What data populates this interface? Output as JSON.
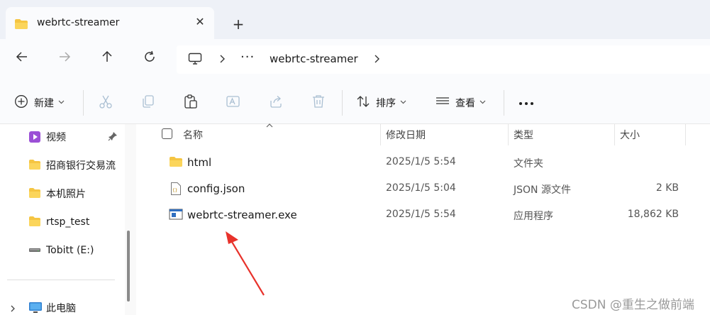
{
  "tab": {
    "title": "webrtc-streamer",
    "close_glyph": "✕",
    "new_glyph": "+"
  },
  "address": {
    "ellipsis": "···",
    "crumb": "webrtc-streamer"
  },
  "toolbar": {
    "new_label": "新建",
    "sort_label": "排序",
    "view_label": "查看",
    "more_glyph": "•••",
    "caret": "⌄"
  },
  "sidebar": {
    "items": [
      {
        "label": "视频",
        "icon": "video-library-icon",
        "pinned": true
      },
      {
        "label": "招商银行交易流",
        "icon": "folder-icon"
      },
      {
        "label": "本机照片",
        "icon": "folder-icon"
      },
      {
        "label": "rtsp_test",
        "icon": "folder-icon"
      },
      {
        "label": "Tobitt (E:)",
        "icon": "drive-icon"
      },
      {
        "label": "此电脑",
        "icon": "computer-icon"
      }
    ]
  },
  "columns": {
    "name": "名称",
    "modified": "修改日期",
    "type": "类型",
    "size": "大小"
  },
  "files": [
    {
      "name": "html",
      "modified": "2025/1/5 5:54",
      "type": "文件夹",
      "size": "",
      "icon": "folder-icon"
    },
    {
      "name": "config.json",
      "modified": "2025/1/5 5:04",
      "type": "JSON 源文件",
      "size": "2 KB",
      "icon": "json-file-icon"
    },
    {
      "name": "webrtc-streamer.exe",
      "modified": "2025/1/5 5:54",
      "type": "应用程序",
      "size": "18,862 KB",
      "icon": "exe-file-icon"
    }
  ],
  "watermark": "CSDN @重生之做前端",
  "colors": {
    "folder": "#f5c542",
    "accent": "#0067c0",
    "arrow": "#e8322b"
  }
}
